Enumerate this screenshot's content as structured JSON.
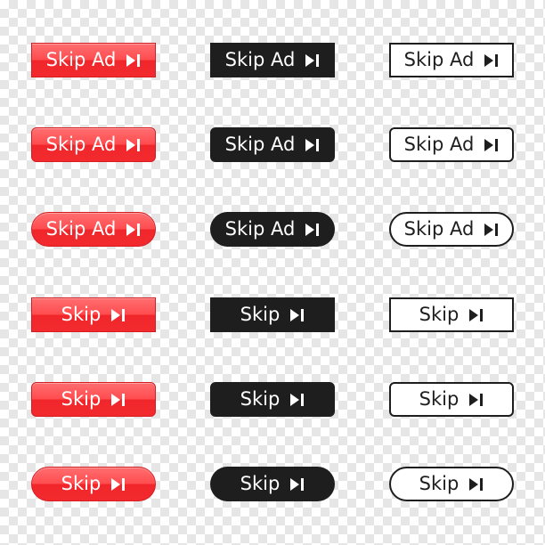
{
  "labels": {
    "skip_ad": "Skip Ad",
    "skip": "Skip"
  },
  "icons": {
    "skip_next": "skip-next-icon"
  },
  "colors": {
    "red": "#ff4d50",
    "black": "#1e1e1e",
    "white": "#ffffff"
  }
}
